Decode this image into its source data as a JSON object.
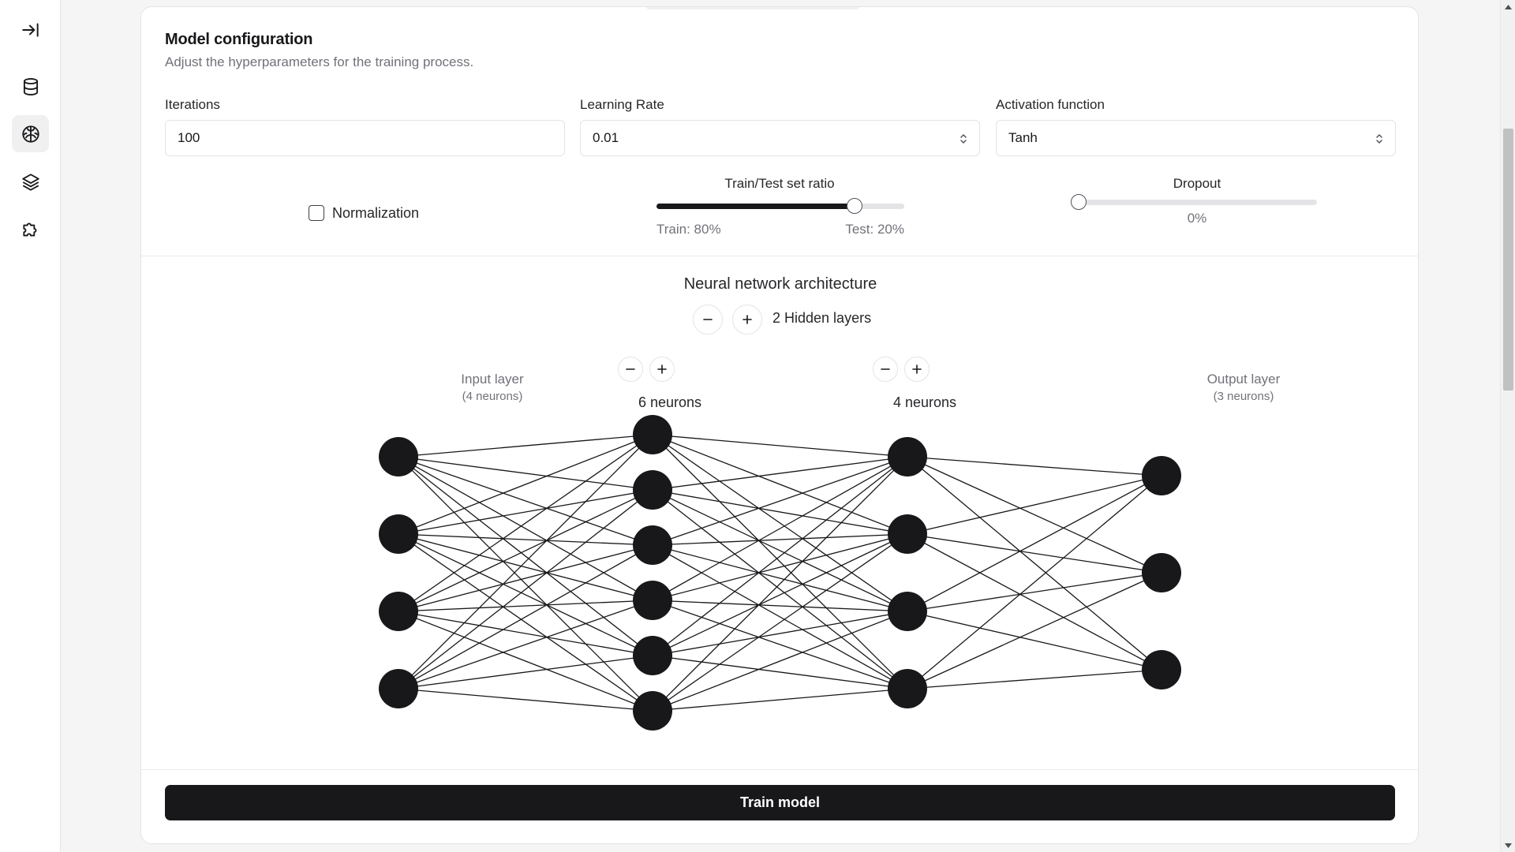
{
  "sidebar": {
    "items": [
      {
        "icon": "collapse-sidebar-icon",
        "active": false
      },
      {
        "icon": "database-icon",
        "active": false
      },
      {
        "icon": "brain-icon",
        "active": true
      },
      {
        "icon": "layers-icon",
        "active": false
      },
      {
        "icon": "puzzle-icon",
        "active": false
      }
    ]
  },
  "card": {
    "title": "Model configuration",
    "description": "Adjust the hyperparameters for the training process."
  },
  "fields": {
    "iterations": {
      "label": "Iterations",
      "value": "100"
    },
    "learning_rate": {
      "label": "Learning Rate",
      "value": "0.01"
    },
    "activation": {
      "label": "Activation function",
      "value": "Tanh"
    }
  },
  "normalization": {
    "label": "Normalization",
    "checked": false
  },
  "split": {
    "title": "Train/Test set ratio",
    "train_text": "Train: 80%",
    "test_text": "Test: 20%",
    "train_fraction": 0.8
  },
  "dropout": {
    "title": "Dropout",
    "value_text": "0%",
    "fraction": 0.0
  },
  "architecture": {
    "title": "Neural network architecture",
    "hidden_layers_text": "2 Hidden layers",
    "input": {
      "name": "Input layer",
      "sub": "(4 neurons)",
      "neurons": 4
    },
    "hidden": [
      {
        "text": "6 neurons",
        "neurons": 6
      },
      {
        "text": "4 neurons",
        "neurons": 4
      }
    ],
    "output": {
      "name": "Output layer",
      "sub": "(3 neurons)",
      "neurons": 3
    }
  },
  "train_button": "Train model",
  "colors": {
    "accent": "#18181b",
    "muted_text": "#71717a",
    "border": "#e4e4e7"
  }
}
